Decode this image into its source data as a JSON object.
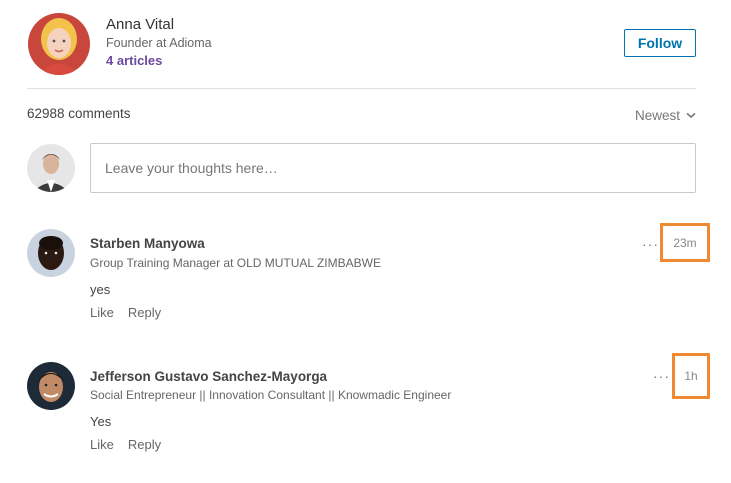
{
  "author": {
    "name": "Anna Vital",
    "headline": "Founder at Adioma",
    "articles": "4 articles",
    "follow_label": "Follow"
  },
  "comments_header": {
    "count": "62988 comments",
    "sort_label": "Newest"
  },
  "compose": {
    "placeholder": "Leave your thoughts here…"
  },
  "comments": [
    {
      "name": "Starben Manyowa",
      "headline": "Group Training Manager at OLD MUTUAL ZIMBABWE",
      "text": "yes",
      "time": "23m",
      "like_label": "Like",
      "reply_label": "Reply",
      "more_label": "···"
    },
    {
      "name": "Jefferson Gustavo Sanchez-Mayorga",
      "headline": "Social Entrepreneur || Innovation Consultant || Knowmadic Engineer",
      "text": "Yes",
      "time": "1h",
      "like_label": "Like",
      "reply_label": "Reply",
      "more_label": "···"
    }
  ],
  "colors": {
    "accent": "#0073b1",
    "articles_link": "#6c4a9e",
    "highlight": "#f08a32"
  },
  "icons": {
    "sort": "chevron-down-icon",
    "more": "more-horizontal-icon"
  }
}
